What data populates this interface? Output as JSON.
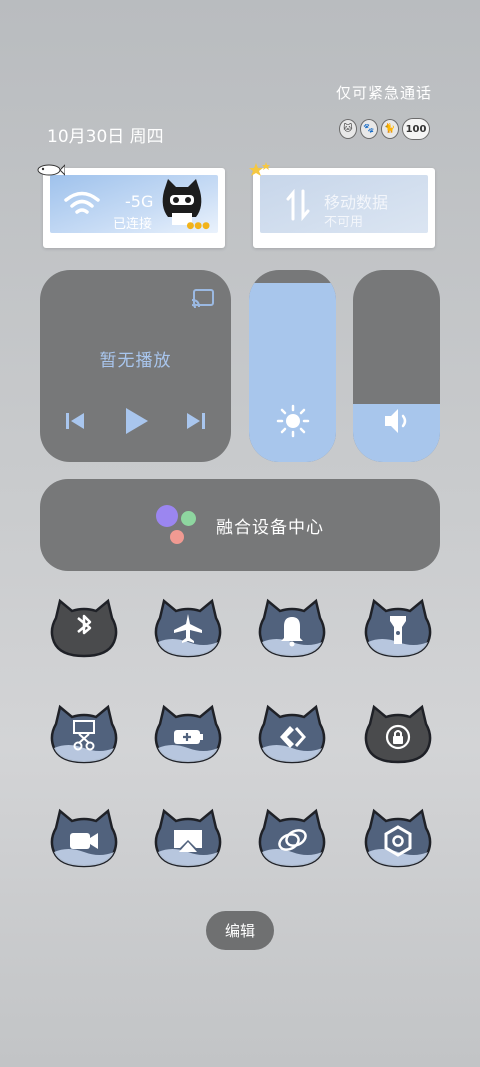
{
  "status": {
    "emergency_text": "仅可紧急通话",
    "date_text": "10月30日 周四",
    "sticker_badge": "100"
  },
  "network_cards": {
    "wifi": {
      "title": "-5G",
      "subtitle": "已连接"
    },
    "mobile": {
      "title": "移动数据",
      "subtitle": "不可用"
    }
  },
  "media": {
    "label": "暂无播放"
  },
  "sliders": {
    "brightness_level": 0.93,
    "volume_level": 0.3
  },
  "fusion": {
    "label": "融合设备中心",
    "dot_colors": [
      "#9b86f0",
      "#8ed6a0",
      "#f09a92"
    ]
  },
  "toggles": [
    {
      "icon": "bluetooth-icon",
      "active": false
    },
    {
      "icon": "airplane-icon",
      "active": true
    },
    {
      "icon": "bell-icon",
      "active": true
    },
    {
      "icon": "flashlight-icon",
      "active": true
    },
    {
      "icon": "screenshot-scissors-icon",
      "active": true
    },
    {
      "icon": "battery-saver-icon",
      "active": true
    },
    {
      "icon": "nearby-share-icon",
      "active": true
    },
    {
      "icon": "rotation-lock-icon",
      "active": false
    },
    {
      "icon": "screen-record-icon",
      "active": true
    },
    {
      "icon": "screen-cast-icon",
      "active": true
    },
    {
      "icon": "multi-screen-link-icon",
      "active": true
    },
    {
      "icon": "nfc-hex-icon",
      "active": true
    }
  ],
  "colors": {
    "tile_bg": "#777879",
    "accent_blue": "#a8c6ec",
    "cat_dark": "#51627d",
    "cat_off": "#4a4b4d"
  },
  "edit": {
    "label": "编辑"
  }
}
